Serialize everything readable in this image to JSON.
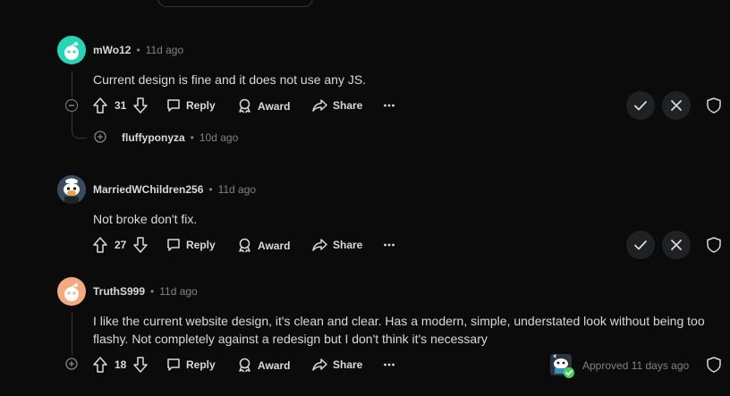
{
  "comments": [
    {
      "username": "mWo12",
      "time": "11d ago",
      "body": "Current design is fine and it does not use any JS.",
      "votes": "31",
      "reply_label": "Reply",
      "award_label": "Award",
      "share_label": "Share"
    },
    {
      "username": "MarriedWChildren256",
      "time": "11d ago",
      "body": "Not broke don't fix.",
      "votes": "27",
      "reply_label": "Reply",
      "award_label": "Award",
      "share_label": "Share"
    },
    {
      "username": "TruthS999",
      "time": "11d ago",
      "body": "I like the current website design, it's clean and clear. Has a modern, simple, understated look without being too flashy. Not completely against a redesign but I don't think it's necessary",
      "votes": "18",
      "reply_label": "Reply",
      "award_label": "Award",
      "share_label": "Share",
      "approved_text": "Approved 11 days ago"
    }
  ],
  "collapsed_reply": {
    "username": "fluffyponyza",
    "time": "10d ago"
  },
  "separator": "•",
  "colors": {
    "background": "#0b0b0c",
    "text": "#d7dadc",
    "muted": "#818384",
    "approved_badge": "#46d160",
    "avatar1": "#24d6b4",
    "avatar3": "#f4a97e"
  }
}
